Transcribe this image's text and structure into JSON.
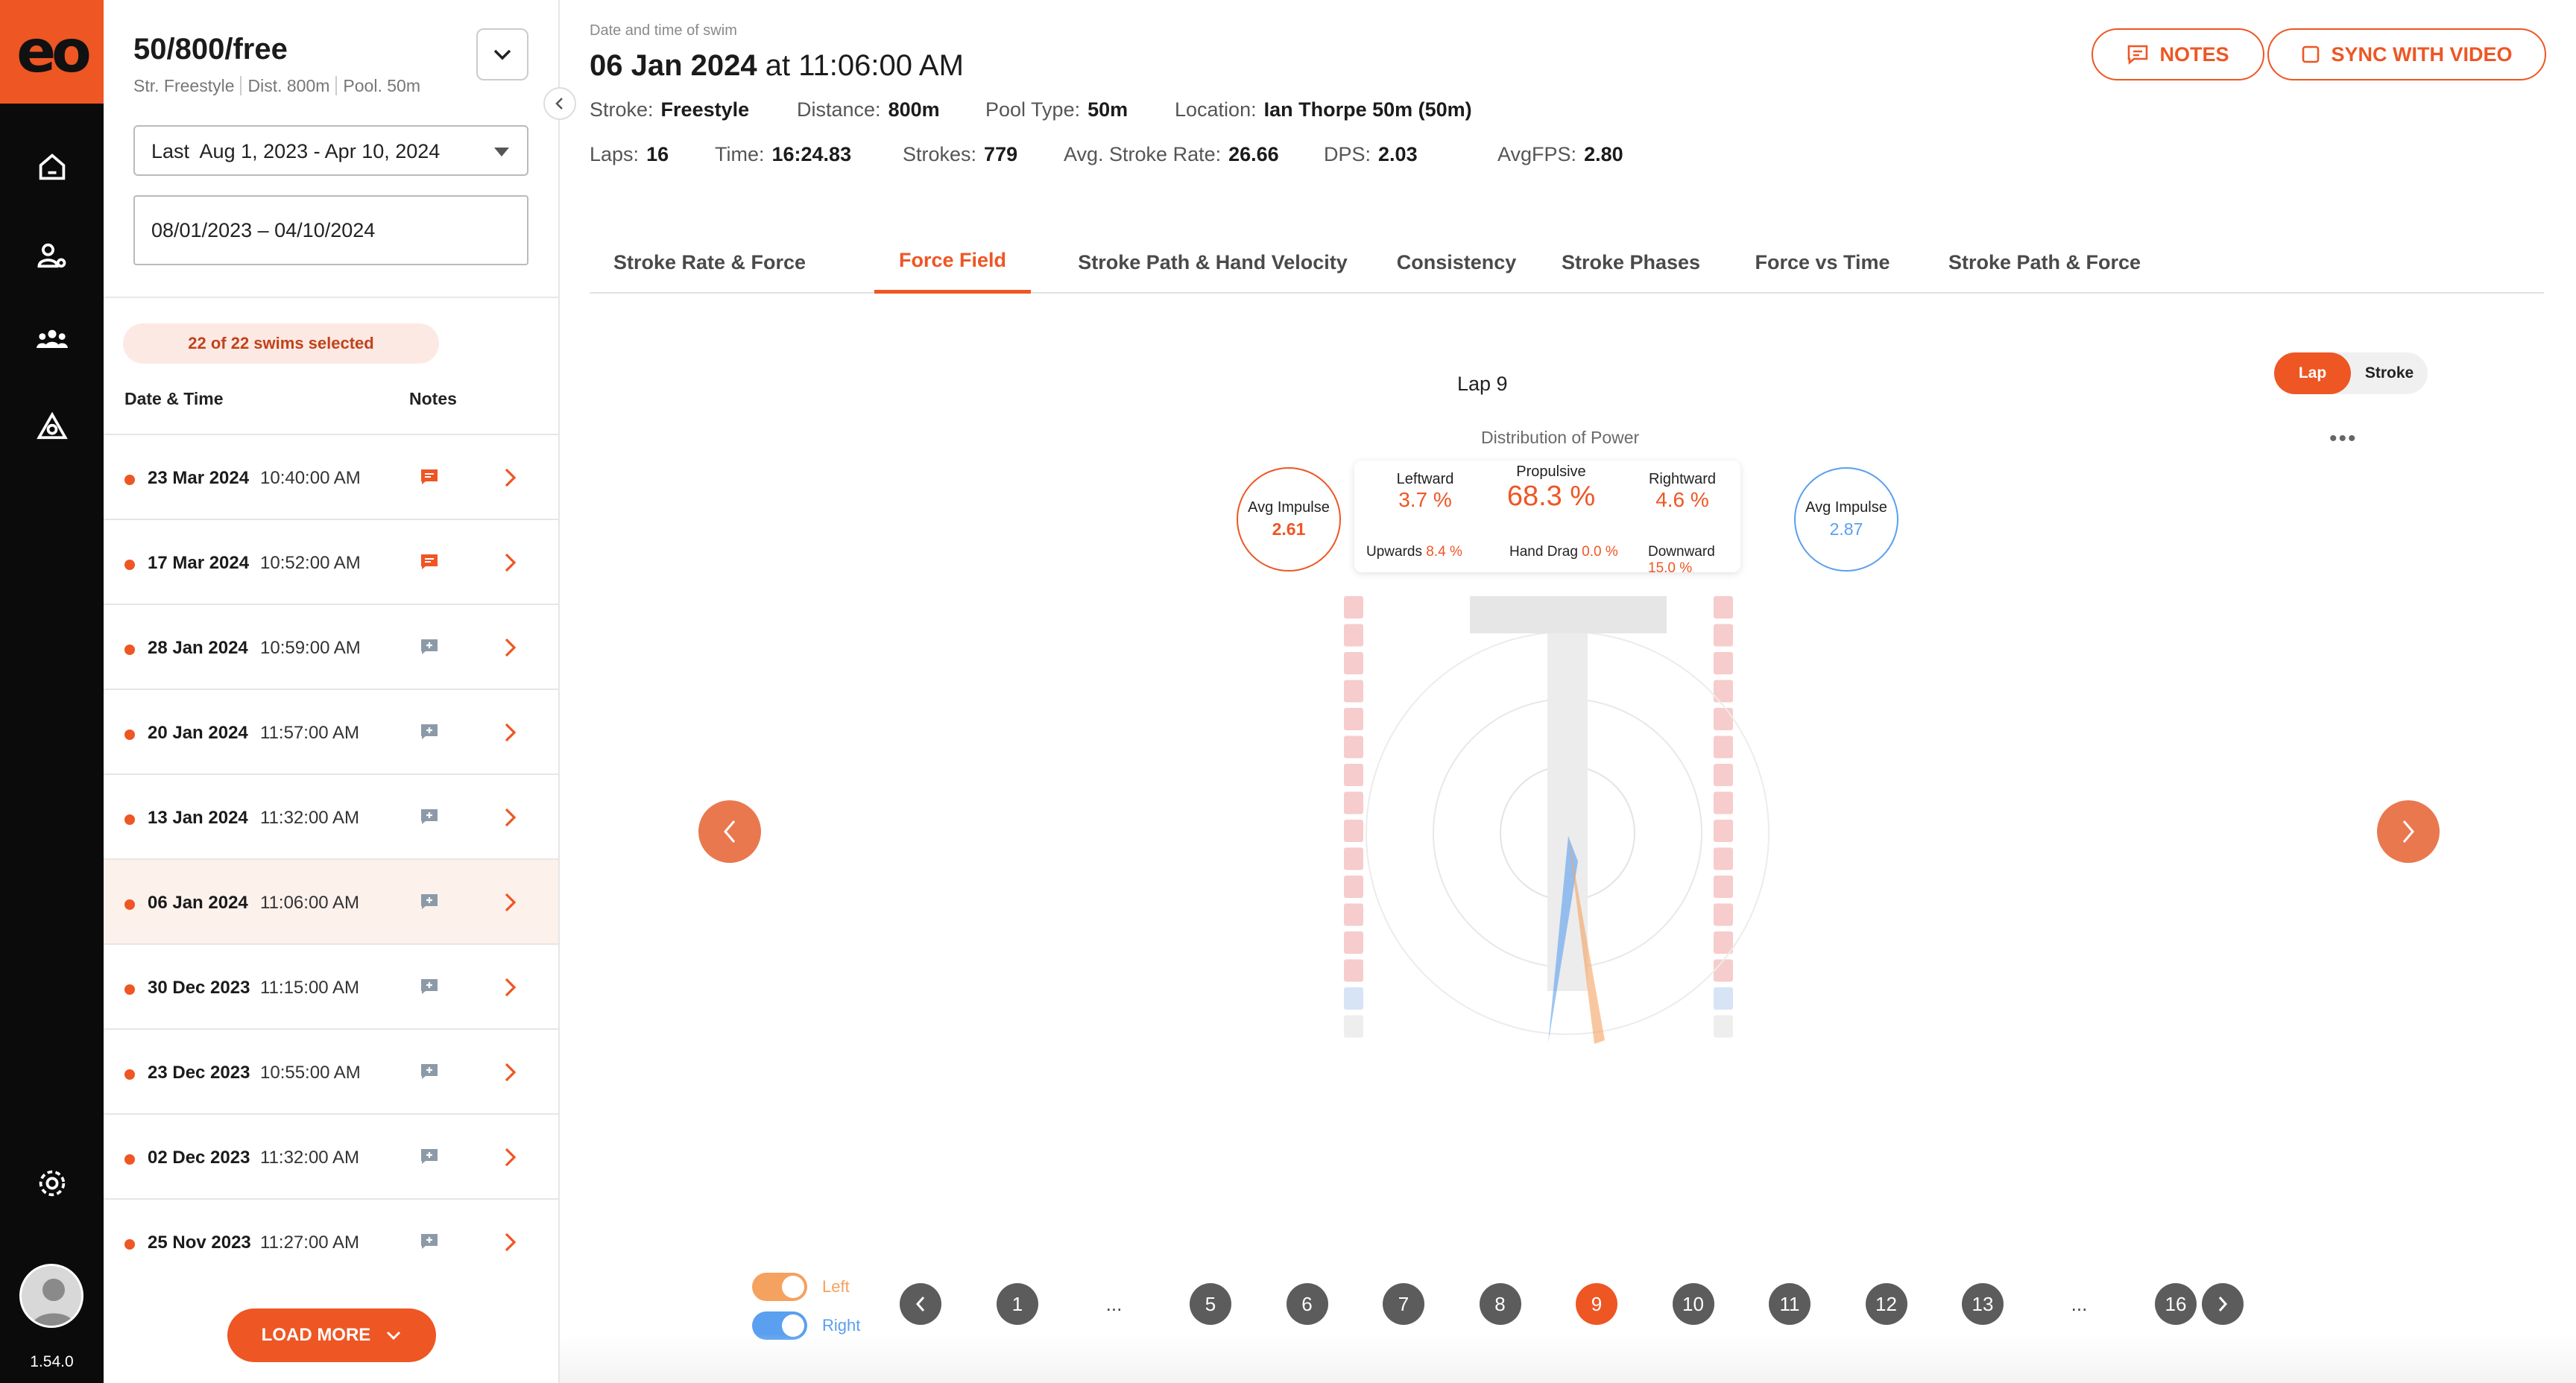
{
  "app": {
    "logo_text": "eo",
    "version": "1.54.0"
  },
  "rail": {
    "icons": [
      "home-icon",
      "athlete-settings-icon",
      "team-icon",
      "swimmer-icon",
      "settings-icon"
    ]
  },
  "sidebar": {
    "swim_title": "50/800/free",
    "sub_stroke": "Str. Freestyle",
    "sub_dist": "Dist. 800m",
    "sub_pool": "Pool. 50m",
    "range_label": "Last  Aug 1, 2023 - Apr 10, 2024",
    "date_input_value": "08/01/2023 – 04/10/2024",
    "selected_badge": "22 of 22 swims selected",
    "col_date": "Date & Time",
    "col_notes": "Notes",
    "load_more": "LOAD MORE",
    "rows": [
      {
        "date": "23 Mar 2024",
        "time": "10:40:00 AM",
        "has_note": true
      },
      {
        "date": "17 Mar 2024",
        "time": "10:52:00 AM",
        "has_note": true
      },
      {
        "date": "28 Jan 2024",
        "time": "10:59:00 AM",
        "has_note": false
      },
      {
        "date": "20 Jan 2024",
        "time": "11:57:00 AM",
        "has_note": false
      },
      {
        "date": "13 Jan 2024",
        "time": "11:32:00 AM",
        "has_note": false
      },
      {
        "date": "06 Jan 2024",
        "time": "11:06:00 AM",
        "has_note": false,
        "selected": true
      },
      {
        "date": "30 Dec 2023",
        "time": "11:15:00 AM",
        "has_note": false
      },
      {
        "date": "23 Dec 2023",
        "time": "10:55:00 AM",
        "has_note": false
      },
      {
        "date": "02 Dec 2023",
        "time": "11:32:00 AM",
        "has_note": false
      },
      {
        "date": "25 Nov 2023",
        "time": "11:27:00 AM",
        "has_note": false
      }
    ]
  },
  "header": {
    "caption": "Date and time of swim",
    "date": "06 Jan 2024",
    "at": "at",
    "time": "11:06:00 AM",
    "notes_btn": "NOTES",
    "sync_btn": "SYNC WITH VIDEO",
    "meta1": [
      {
        "label": "Stroke:",
        "value": "Freestyle"
      },
      {
        "label": "Distance:",
        "value": "800m"
      },
      {
        "label": "Pool Type:",
        "value": "50m"
      },
      {
        "label": "Location:",
        "value": "Ian Thorpe 50m (50m)"
      }
    ],
    "meta2": [
      {
        "label": "Laps:",
        "value": "16"
      },
      {
        "label": "Time:",
        "value": "16:24.83"
      },
      {
        "label": "Strokes:",
        "value": "779"
      },
      {
        "label": "Avg. Stroke Rate:",
        "value": "26.66"
      },
      {
        "label": "DPS:",
        "value": "2.03"
      },
      {
        "label": "AvgFPS:",
        "value": "2.80"
      }
    ]
  },
  "tabs": [
    "Stroke Rate & Force",
    "Force Field",
    "Stroke Path & Hand Velocity",
    "Consistency",
    "Stroke Phases",
    "Force vs Time",
    "Stroke Path & Force"
  ],
  "active_tab": "Force Field",
  "panel": {
    "lap_title": "Lap 9",
    "seg_lap": "Lap",
    "seg_stroke": "Stroke",
    "dist_title": "Distribution of Power",
    "left_impulse_label": "Avg Impulse",
    "left_impulse_value": "2.61",
    "right_impulse_label": "Avg Impulse",
    "right_impulse_value": "2.87",
    "leftward_label": "Leftward",
    "leftward_value": "3.7 %",
    "propulsive_label": "Propulsive",
    "propulsive_value": "68.3 %",
    "rightward_label": "Rightward",
    "rightward_value": "4.6 %",
    "upwards_label": "Upwards",
    "upwards_value": "8.4 %",
    "handdrag_label": "Hand Drag",
    "handdrag_value": "0.0 %",
    "downward_label": "Downward",
    "downward_value": "15.0 %",
    "toggle_left": "Left",
    "toggle_right": "Right",
    "pages": [
      "1",
      "...",
      "5",
      "6",
      "7",
      "8",
      "9",
      "10",
      "11",
      "12",
      "13",
      "...",
      "16"
    ],
    "active_page": "9"
  },
  "colors": {
    "accent": "#ee5624",
    "left_hand": "#f5a15f",
    "right_hand": "#5a9ff0"
  }
}
